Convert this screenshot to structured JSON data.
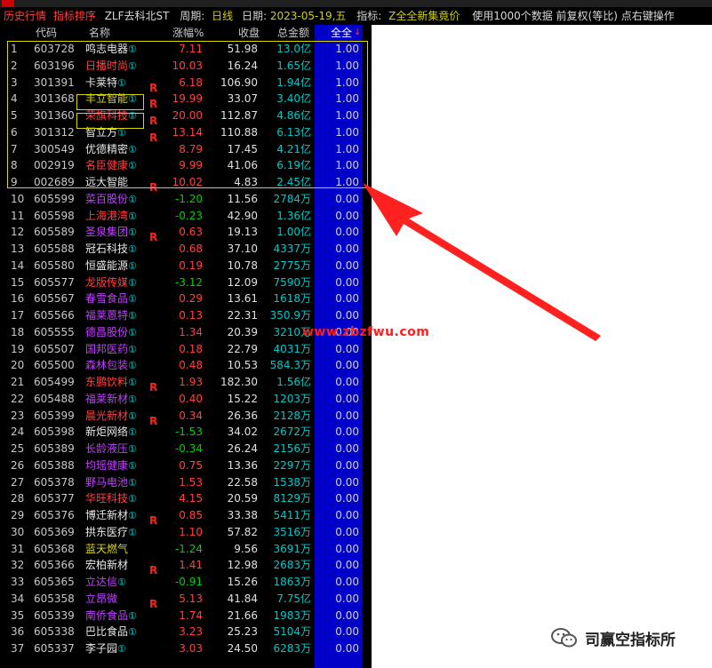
{
  "infobar": {
    "tab": "历史行情",
    "sort_label": "指标排序",
    "indicator_name": "ZLF去科北ST",
    "period_label": "周期:",
    "period_value": "日线",
    "date_label": "日期:",
    "date_value": "2023-05-19,五",
    "indicator_label": "指标:",
    "indicator_value": "Z全全新集竟价",
    "note": "使用1000个数据 前复权(等比) 点右键操作"
  },
  "columns": {
    "code": "代码",
    "name": "名称",
    "change": "涨幅%",
    "close": "收盘",
    "amount": "总金额",
    "all": "全全"
  },
  "rows": [
    {
      "idx": "1",
      "code": "603728",
      "name": "鸣志电器",
      "name_color": "#e8e8e8",
      "circle": "①",
      "r": "",
      "chg": "7.11",
      "dir": "up",
      "close": "51.98",
      "amount": "13.0亿",
      "all": "1.00"
    },
    {
      "idx": "2",
      "code": "603196",
      "name": "日播时尚",
      "name_color": "#ff4040",
      "circle": "①",
      "r": "",
      "chg": "10.03",
      "dir": "up",
      "close": "16.24",
      "amount": "1.65亿",
      "all": "1.00"
    },
    {
      "idx": "3",
      "code": "301391",
      "name": "卡莱特",
      "name_color": "#e8e8e8",
      "circle": "①",
      "r": "R",
      "chg": "6.18",
      "dir": "up",
      "close": "106.90",
      "amount": "1.94亿",
      "all": "1.00"
    },
    {
      "idx": "4",
      "code": "301368",
      "name": "丰立智能",
      "name_color": "#d8d800",
      "circle": "①",
      "r": "R",
      "chg": "19.99",
      "dir": "up",
      "close": "33.07",
      "amount": "3.40亿",
      "all": "1.00"
    },
    {
      "idx": "5",
      "code": "301360",
      "name": "荣旗科技",
      "name_color": "#ff4040",
      "circle": "①",
      "r": "R",
      "chg": "20.00",
      "dir": "up",
      "close": "112.87",
      "amount": "4.86亿",
      "all": "1.00"
    },
    {
      "idx": "6",
      "code": "301312",
      "name": "智立方",
      "name_color": "#e8e8e8",
      "circle": "①",
      "r": "R",
      "chg": "13.14",
      "dir": "up",
      "close": "110.88",
      "amount": "6.13亿",
      "all": "1.00"
    },
    {
      "idx": "7",
      "code": "300549",
      "name": "优德精密",
      "name_color": "#e8e8e8",
      "circle": "①",
      "r": "",
      "chg": "8.79",
      "dir": "up",
      "close": "17.45",
      "amount": "4.21亿",
      "all": "1.00"
    },
    {
      "idx": "8",
      "code": "002919",
      "name": "名臣健康",
      "name_color": "#ff4040",
      "circle": "①",
      "r": "",
      "chg": "9.99",
      "dir": "up",
      "close": "41.06",
      "amount": "6.19亿",
      "all": "1.00"
    },
    {
      "idx": "9",
      "code": "002689",
      "name": "远大智能",
      "name_color": "#e8e8e8",
      "circle": "",
      "r": "R",
      "chg": "10.02",
      "dir": "up",
      "close": "4.83",
      "amount": "2.45亿",
      "all": "1.00"
    },
    {
      "idx": "10",
      "code": "605599",
      "name": "菜百股份",
      "name_color": "#c040ff",
      "circle": "①",
      "r": "",
      "chg": "-1.20",
      "dir": "down",
      "close": "11.56",
      "amount": "2784万",
      "all": "0.00"
    },
    {
      "idx": "11",
      "code": "605598",
      "name": "上海港湾",
      "name_color": "#ff4040",
      "circle": "①",
      "r": "",
      "chg": "-0.23",
      "dir": "down",
      "close": "42.90",
      "amount": "1.36亿",
      "all": "0.00"
    },
    {
      "idx": "12",
      "code": "605589",
      "name": "圣泉集团",
      "name_color": "#c040ff",
      "circle": "①",
      "r": "R",
      "chg": "0.63",
      "dir": "up",
      "close": "19.13",
      "amount": "1.00亿",
      "all": "0.00"
    },
    {
      "idx": "13",
      "code": "605588",
      "name": "冠石科技",
      "name_color": "#e8e8e8",
      "circle": "①",
      "r": "",
      "chg": "0.68",
      "dir": "up",
      "close": "37.10",
      "amount": "4337万",
      "all": "0.00"
    },
    {
      "idx": "14",
      "code": "605580",
      "name": "恒盛能源",
      "name_color": "#e8e8e8",
      "circle": "①",
      "r": "",
      "chg": "0.19",
      "dir": "up",
      "close": "10.78",
      "amount": "2775万",
      "all": "0.00"
    },
    {
      "idx": "15",
      "code": "605577",
      "name": "龙版传媒",
      "name_color": "#ff4040",
      "circle": "①",
      "r": "",
      "chg": "-3.12",
      "dir": "down",
      "close": "12.09",
      "amount": "7590万",
      "all": "0.00"
    },
    {
      "idx": "16",
      "code": "605567",
      "name": "春雪食品",
      "name_color": "#c040ff",
      "circle": "①",
      "r": "",
      "chg": "0.29",
      "dir": "up",
      "close": "13.61",
      "amount": "1618万",
      "all": "0.00"
    },
    {
      "idx": "17",
      "code": "605566",
      "name": "福莱蒽特",
      "name_color": "#c040ff",
      "circle": "①",
      "r": "",
      "chg": "0.13",
      "dir": "up",
      "close": "22.31",
      "amount": "350.9万",
      "all": "0.00"
    },
    {
      "idx": "18",
      "code": "605555",
      "name": "德昌股份",
      "name_color": "#c040ff",
      "circle": "①",
      "r": "",
      "chg": "1.34",
      "dir": "up",
      "close": "20.39",
      "amount": "3210万",
      "all": "0.00"
    },
    {
      "idx": "19",
      "code": "605507",
      "name": "国邦医药",
      "name_color": "#c040ff",
      "circle": "①",
      "r": "",
      "chg": "0.18",
      "dir": "up",
      "close": "22.79",
      "amount": "4031万",
      "all": "0.00"
    },
    {
      "idx": "20",
      "code": "605500",
      "name": "森林包装",
      "name_color": "#c040ff",
      "circle": "①",
      "r": "",
      "chg": "0.48",
      "dir": "up",
      "close": "10.53",
      "amount": "584.3万",
      "all": "0.00"
    },
    {
      "idx": "21",
      "code": "605499",
      "name": "东鹏饮料",
      "name_color": "#ff4040",
      "circle": "①",
      "r": "R",
      "chg": "1.93",
      "dir": "up",
      "close": "182.30",
      "amount": "1.56亿",
      "all": "0.00"
    },
    {
      "idx": "22",
      "code": "605488",
      "name": "福莱新材",
      "name_color": "#c040ff",
      "circle": "①",
      "r": "",
      "chg": "0.40",
      "dir": "up",
      "close": "15.22",
      "amount": "1203万",
      "all": "0.00"
    },
    {
      "idx": "23",
      "code": "605399",
      "name": "晨光新材",
      "name_color": "#ff4040",
      "circle": "①",
      "r": "R",
      "chg": "0.34",
      "dir": "up",
      "close": "26.36",
      "amount": "2128万",
      "all": "0.00"
    },
    {
      "idx": "24",
      "code": "605398",
      "name": "新炬网络",
      "name_color": "#e8e8e8",
      "circle": "①",
      "r": "",
      "chg": "-1.53",
      "dir": "down",
      "close": "34.02",
      "amount": "2672万",
      "all": "0.00"
    },
    {
      "idx": "25",
      "code": "605389",
      "name": "长龄液压",
      "name_color": "#c040ff",
      "circle": "①",
      "r": "",
      "chg": "-0.34",
      "dir": "down",
      "close": "26.24",
      "amount": "2156万",
      "all": "0.00"
    },
    {
      "idx": "26",
      "code": "605388",
      "name": "均瑶健康",
      "name_color": "#c040ff",
      "circle": "①",
      "r": "",
      "chg": "0.75",
      "dir": "up",
      "close": "13.36",
      "amount": "2297万",
      "all": "0.00"
    },
    {
      "idx": "27",
      "code": "605378",
      "name": "野马电池",
      "name_color": "#c040ff",
      "circle": "①",
      "r": "",
      "chg": "1.53",
      "dir": "up",
      "close": "22.58",
      "amount": "1538万",
      "all": "0.00"
    },
    {
      "idx": "28",
      "code": "605377",
      "name": "华旺科技",
      "name_color": "#ff4040",
      "circle": "①",
      "r": "",
      "chg": "4.15",
      "dir": "up",
      "close": "20.59",
      "amount": "8129万",
      "all": "0.00"
    },
    {
      "idx": "29",
      "code": "605376",
      "name": "博迁新材",
      "name_color": "#e8e8e8",
      "circle": "①",
      "r": "R",
      "chg": "0.85",
      "dir": "up",
      "close": "33.38",
      "amount": "5411万",
      "all": "0.00"
    },
    {
      "idx": "30",
      "code": "605369",
      "name": "拱东医疗",
      "name_color": "#e8e8e8",
      "circle": "①",
      "r": "",
      "chg": "1.10",
      "dir": "up",
      "close": "57.82",
      "amount": "3516万",
      "all": "0.00"
    },
    {
      "idx": "31",
      "code": "605368",
      "name": "蓝天燃气",
      "name_color": "#d8d800",
      "circle": "",
      "r": "",
      "chg": "-1.24",
      "dir": "down",
      "close": "9.56",
      "amount": "3691万",
      "all": "0.00"
    },
    {
      "idx": "32",
      "code": "605366",
      "name": "宏柏新材",
      "name_color": "#e8e8e8",
      "circle": "",
      "r": "R",
      "chg": "1.41",
      "dir": "up",
      "close": "12.98",
      "amount": "2683万",
      "all": "0.00"
    },
    {
      "idx": "33",
      "code": "605365",
      "name": "立达信",
      "name_color": "#c040ff",
      "circle": "①",
      "r": "",
      "chg": "-0.91",
      "dir": "down",
      "close": "15.26",
      "amount": "1863万",
      "all": "0.00"
    },
    {
      "idx": "34",
      "code": "605358",
      "name": "立昂微",
      "name_color": "#c040ff",
      "circle": "",
      "r": "R",
      "chg": "5.13",
      "dir": "up",
      "close": "41.84",
      "amount": "7.75亿",
      "all": "0.00"
    },
    {
      "idx": "35",
      "code": "605339",
      "name": "南侨食品",
      "name_color": "#c040ff",
      "circle": "①",
      "r": "",
      "chg": "1.74",
      "dir": "up",
      "close": "21.66",
      "amount": "1983万",
      "all": "0.00"
    },
    {
      "idx": "36",
      "code": "605338",
      "name": "巴比食品",
      "name_color": "#e8e8e8",
      "circle": "①",
      "r": "",
      "chg": "3.23",
      "dir": "up",
      "close": "25.23",
      "amount": "5104万",
      "all": "0.00"
    },
    {
      "idx": "37",
      "code": "605337",
      "name": "李子园",
      "name_color": "#e8e8e8",
      "circle": "①",
      "r": "",
      "chg": "3.03",
      "dir": "up",
      "close": "24.50",
      "amount": "6283万",
      "all": "0.00"
    }
  ],
  "watermark": "www.zbzfwu.com",
  "brand": {
    "text": "司赢空指标所",
    "icon": "wechat-icon"
  }
}
